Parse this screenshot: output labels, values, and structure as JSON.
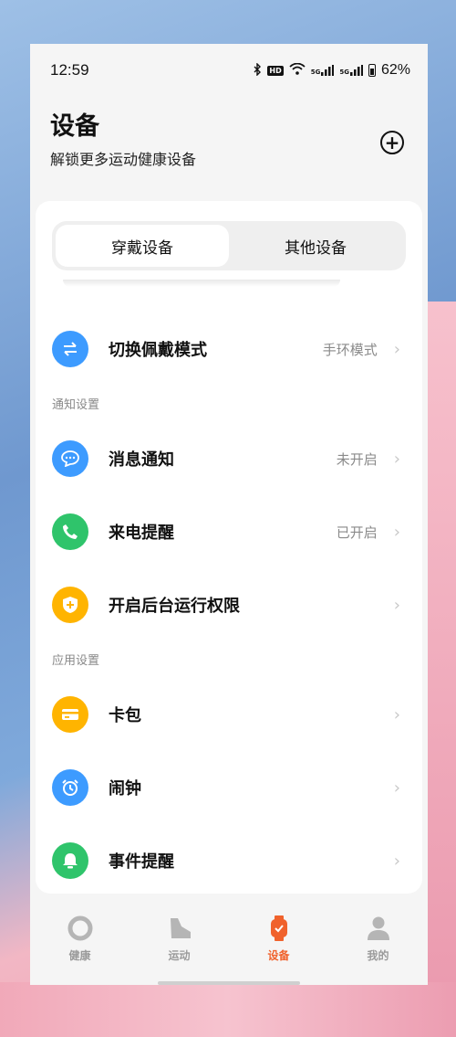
{
  "status_bar": {
    "time": "12:59",
    "battery_percent": "62%",
    "hd_badge": "HD",
    "signal_1": "5G",
    "signal_2": "5G"
  },
  "header": {
    "title": "设备",
    "subtitle": "解锁更多运动健康设备"
  },
  "tabs": [
    {
      "label": "穿戴设备",
      "active": true
    },
    {
      "label": "其他设备",
      "active": false
    }
  ],
  "rows": {
    "switch_mode": {
      "label": "切换佩戴模式",
      "value": "手环模式",
      "icon": "switch-arrows-icon",
      "color": "#3d9bff"
    },
    "notify_section": "通知设置",
    "messages": {
      "label": "消息通知",
      "value": "未开启",
      "icon": "message-icon",
      "color": "#3d9bff"
    },
    "calls": {
      "label": "来电提醒",
      "value": "已开启",
      "icon": "phone-icon",
      "color": "#2fc46b"
    },
    "background": {
      "label": "开启后台运行权限",
      "icon": "shield-plus-icon",
      "color": "#ffb400"
    },
    "app_section": "应用设置",
    "wallet": {
      "label": "卡包",
      "icon": "card-icon",
      "color": "#ffb400"
    },
    "alarm": {
      "label": "闹钟",
      "icon": "alarm-clock-icon",
      "color": "#3d9bff"
    },
    "events": {
      "label": "事件提醒",
      "icon": "bell-icon",
      "color": "#2fc46b"
    }
  },
  "bottom_nav": [
    {
      "label": "健康",
      "icon": "ring-icon",
      "active": false
    },
    {
      "label": "运动",
      "icon": "shoe-icon",
      "active": false
    },
    {
      "label": "设备",
      "icon": "watch-icon",
      "active": true
    },
    {
      "label": "我的",
      "icon": "person-icon",
      "active": false
    }
  ],
  "colors": {
    "accent": "#f0622c"
  }
}
